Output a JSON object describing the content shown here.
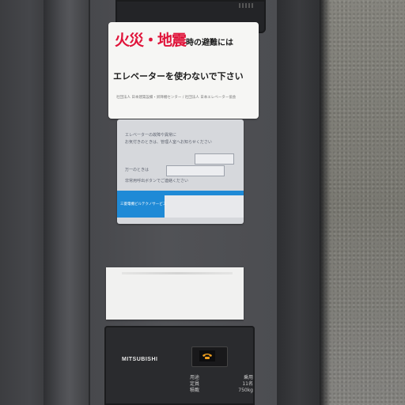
{
  "warning_sign": {
    "title_red": "火災・地震",
    "title_black": "時の避難には",
    "line2": "エレベーターを使わないで下さい",
    "footer": "社団法人 日本建築設備・昇降機センター / 社団法人 日本エレベーター協会"
  },
  "info_sign": {
    "line1": "エレベーターの故障や異常に",
    "line2": "お気付きのときは、管理人室へお知らせください",
    "line3": "万一のときは",
    "line4": "非常用呼出ボタンでご連絡ください",
    "company": "三菱電機ビルテクノサービス"
  },
  "control_panel": {
    "brand": "MITSUBISHI",
    "phone_icon": "phone-icon",
    "specs": [
      {
        "label": "用途",
        "value": "乗用"
      },
      {
        "label": "定員",
        "value": "11名"
      },
      {
        "label": "積載",
        "value": "750kg"
      }
    ]
  }
}
